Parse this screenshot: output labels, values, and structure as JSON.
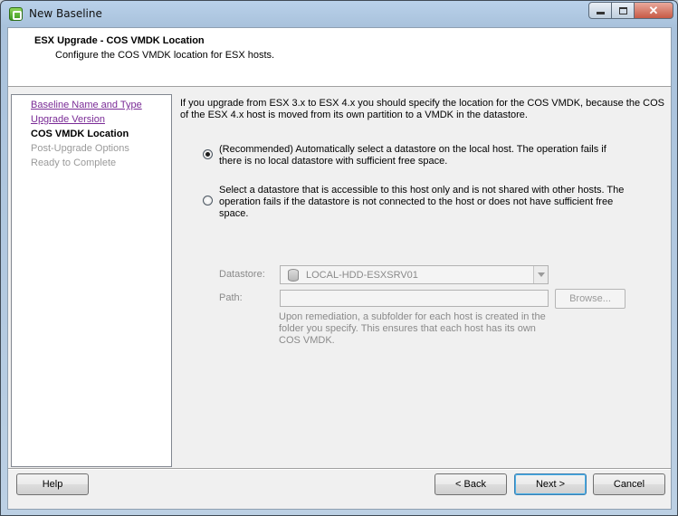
{
  "window": {
    "title": "New Baseline"
  },
  "header": {
    "title": "ESX Upgrade - COS VMDK Location",
    "subtitle": "Configure the COS VMDK location for ESX hosts."
  },
  "nav": {
    "items": [
      {
        "label": "Baseline Name and Type",
        "state": "link"
      },
      {
        "label": "Upgrade Version",
        "state": "link"
      },
      {
        "label": "COS VMDK Location",
        "state": "active"
      },
      {
        "label": "Post-Upgrade Options",
        "state": "disabled"
      },
      {
        "label": "Ready to Complete",
        "state": "disabled"
      }
    ]
  },
  "content": {
    "intro": "If you upgrade from ESX 3.x to ESX 4.x you should specify the location for the COS VMDK, because the COS of the ESX 4.x host is moved from its own partition to a VMDK in the datastore.",
    "options": [
      {
        "text": "(Recommended) Automatically select a datastore on the local host. The operation fails if there is no local datastore with sufficient free space.",
        "selected": true
      },
      {
        "text": "Select a datastore that is accessible to this host only and is not shared with other hosts. The operation fails if the datastore is not connected to the host or does not have sufficient free space.",
        "selected": false
      }
    ],
    "datastore_label": "Datastore:",
    "datastore_value": "LOCAL-HDD-ESXSRV01",
    "path_label": "Path:",
    "path_value": "",
    "browse_label": "Browse...",
    "hint": "Upon remediation, a subfolder for each host is created in the folder you specify. This ensures that each host has its own COS VMDK."
  },
  "buttons": {
    "help": "Help",
    "back": "< Back",
    "next": "Next >",
    "cancel": "Cancel"
  }
}
